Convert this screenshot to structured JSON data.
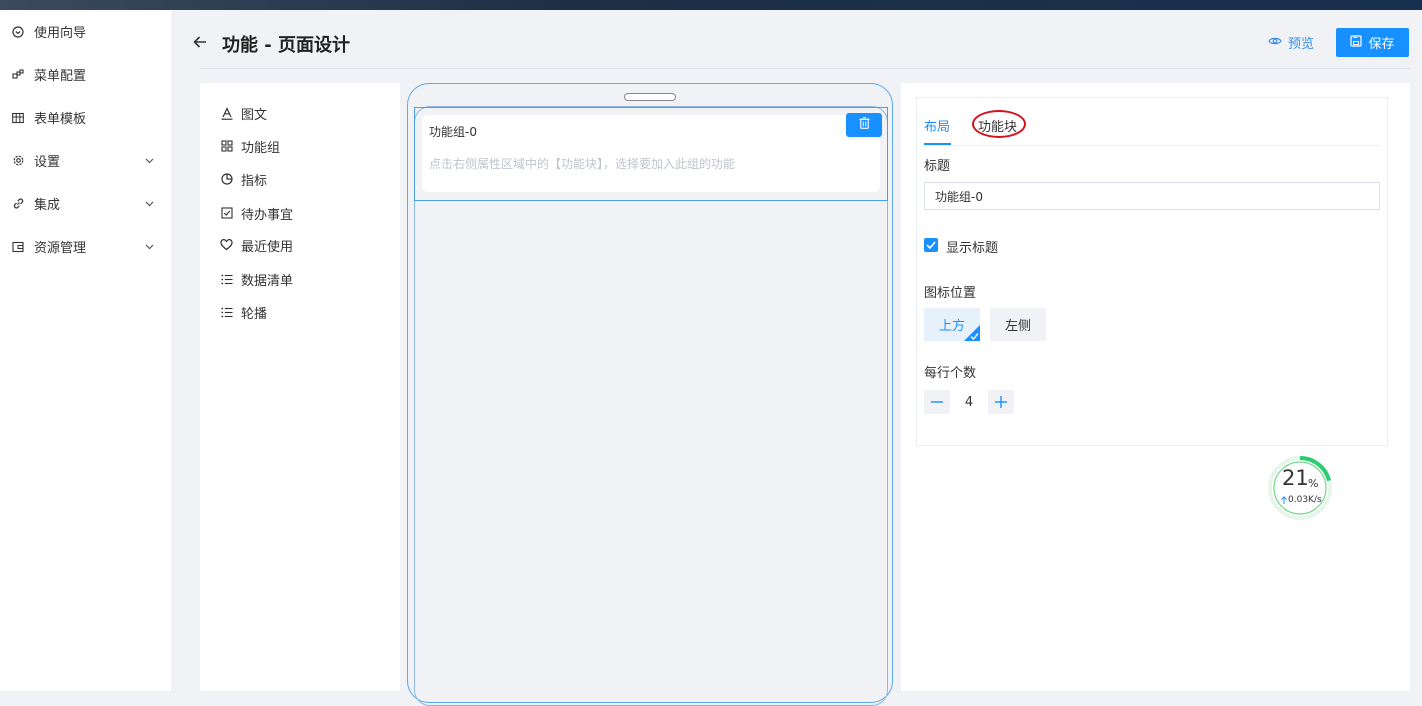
{
  "sidebar": {
    "items": [
      {
        "label": "使用向导",
        "icon": "guide-icon"
      },
      {
        "label": "菜单配置",
        "icon": "menu-config-icon"
      },
      {
        "label": "表单模板",
        "icon": "table-icon"
      },
      {
        "label": "设置",
        "icon": "gear-icon",
        "expandable": true
      },
      {
        "label": "集成",
        "icon": "link-icon",
        "expandable": true
      },
      {
        "label": "资源管理",
        "icon": "wallet-icon",
        "expandable": true
      }
    ]
  },
  "header": {
    "title": "功能 - 页面设计",
    "preview_label": "预览",
    "save_label": "保存"
  },
  "components": {
    "items": [
      {
        "label": "图文",
        "icon": "text-icon"
      },
      {
        "label": "功能组",
        "icon": "grid-icon"
      },
      {
        "label": "指标",
        "icon": "pie-chart-icon"
      },
      {
        "label": "待办事宜",
        "icon": "checkbox-icon"
      },
      {
        "label": "最近使用",
        "icon": "heart-icon"
      },
      {
        "label": "数据清单",
        "icon": "list-icon"
      },
      {
        "label": "轮播",
        "icon": "list-icon"
      }
    ]
  },
  "preview": {
    "group_title": "功能组-0",
    "group_hint": "点击右侧属性区域中的【功能块】，选择要加入此组的功能"
  },
  "properties": {
    "tabs": [
      {
        "label": "布局",
        "active": true
      },
      {
        "label": "功能块",
        "active": false
      }
    ],
    "title_label": "标题",
    "title_value": "功能组-0",
    "show_title_label": "显示标题",
    "show_title_checked": true,
    "icon_position_label": "图标位置",
    "icon_position_options": [
      "上方",
      "左侧"
    ],
    "icon_position_selected": "上方",
    "per_row_label": "每行个数",
    "per_row_value": "4"
  },
  "network_widget": {
    "percent": "21",
    "percent_value": 21,
    "percent_symbol": "%",
    "speed": "0.03K/s"
  },
  "colors": {
    "accent": "#1890ff",
    "annotation": "#d8101c",
    "gauge": "#2ecc71"
  }
}
